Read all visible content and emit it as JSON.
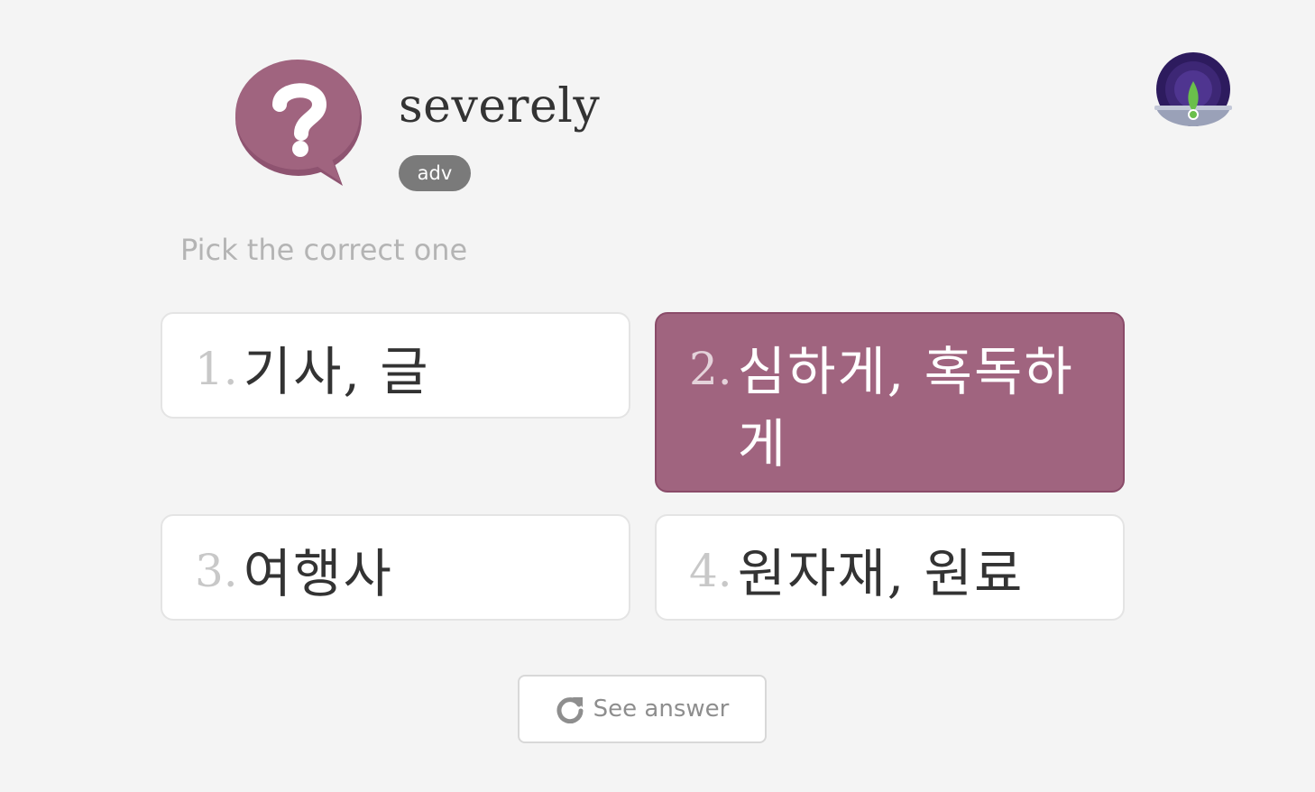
{
  "header": {
    "word": "severely",
    "part_of_speech": "adv",
    "icon": "question-speech-bubble-icon"
  },
  "logo": {
    "icon": "sprout-logo-icon"
  },
  "prompt": "Pick the correct one",
  "options": [
    {
      "number": "1.",
      "text": "기사, 글",
      "selected": false
    },
    {
      "number": "2.",
      "text": "심하게, 혹독하게",
      "selected": true
    },
    {
      "number": "3.",
      "text": "여행사",
      "selected": false
    },
    {
      "number": "4.",
      "text": "원자재, 원료",
      "selected": false
    }
  ],
  "see_answer": {
    "label": "See answer",
    "icon": "refresh-icon"
  },
  "colors": {
    "accent": "#a0647f",
    "background": "#f4f4f4",
    "badge": "#7a7a7a",
    "logo_dark": "#2d1b5e",
    "logo_leaf": "#6abf4b"
  }
}
